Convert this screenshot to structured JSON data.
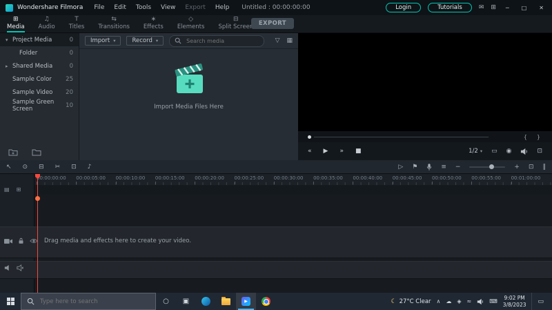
{
  "colors": {
    "accent": "#00c8b4",
    "playhead": "#f4483e"
  },
  "menubar": {
    "app_name": "Wondershare Filmora",
    "menus": [
      "File",
      "Edit",
      "Tools",
      "View",
      "Export",
      "Help"
    ],
    "doc_title": "Untitled : 00:00:00:00",
    "login": "Login",
    "tutorials": "Tutorials"
  },
  "tabs": [
    {
      "label": "Media"
    },
    {
      "label": "Audio"
    },
    {
      "label": "Titles"
    },
    {
      "label": "Transitions"
    },
    {
      "label": "Effects"
    },
    {
      "label": "Elements"
    },
    {
      "label": "Split Screen"
    }
  ],
  "export_label": "EXPORT",
  "sidebar": {
    "items": [
      {
        "label": "Project Media",
        "count": "0"
      },
      {
        "label": "Folder",
        "count": "0"
      },
      {
        "label": "Shared Media",
        "count": "0"
      },
      {
        "label": "Sample Color",
        "count": "25"
      },
      {
        "label": "Sample Video",
        "count": "20"
      },
      {
        "label": "Sample Green Screen",
        "count": "10"
      }
    ]
  },
  "media_panel": {
    "import_label": "Import",
    "record_label": "Record",
    "search_placeholder": "Search media",
    "empty_text": "Import Media Files Here"
  },
  "preview": {
    "ratio": "1/2"
  },
  "timeline": {
    "ruler_labels": [
      "00:00:00:00",
      "00:00:05:00",
      "00:00:10:00",
      "00:00:15:00",
      "00:00:20:00",
      "00:00:25:00",
      "00:00:30:00",
      "00:00:35:00",
      "00:00:40:00",
      "00:00:45:00",
      "00:00:50:00",
      "00:00:55:00",
      "00:01:00:00"
    ],
    "empty_hint": "Drag media and effects here to create your video."
  },
  "taskbar": {
    "search_placeholder": "Type here to search",
    "weather": "27°C Clear",
    "time": "9:02 PM",
    "date": "3/8/2023"
  },
  "icons": {
    "caret_down": "▾",
    "caret_right": "▸",
    "caret_up": "∧",
    "menu_mail": "✉",
    "menu_apps": "⊞",
    "win_min": "─",
    "win_max": "□",
    "win_close": "✕",
    "tab_media": "⊞",
    "tab_audio": "♫",
    "tab_titles": "T",
    "tab_transitions": "⇆",
    "tab_effects": "∗",
    "tab_elements": "◇",
    "tab_split": "⊟",
    "filter": "▽",
    "grid": "▦",
    "step_back": "«",
    "play": "▶",
    "step_fwd": "»",
    "stop": "■",
    "mark_in": "{",
    "mark_out": "}",
    "display": "▭",
    "snapshot": "◉",
    "expand": "⊡",
    "pointer": "↖",
    "magnet": "⊙",
    "trash": "⊟",
    "split": "✂",
    "crop": "⊡",
    "mute": "♪",
    "render": "▷",
    "marker": "⚑",
    "mixer": "≡",
    "zoom_out": "−",
    "zoom_in": "+",
    "fit": "⊡",
    "shortcut": "‖",
    "track_manage": "▤",
    "track_add": "⊞",
    "moon": "☾",
    "cloud": "☁",
    "shield": "◈",
    "wifi": "≈",
    "keyboard": "⌨",
    "cortana": "○",
    "taskview": "▣",
    "action_center": "▭"
  }
}
